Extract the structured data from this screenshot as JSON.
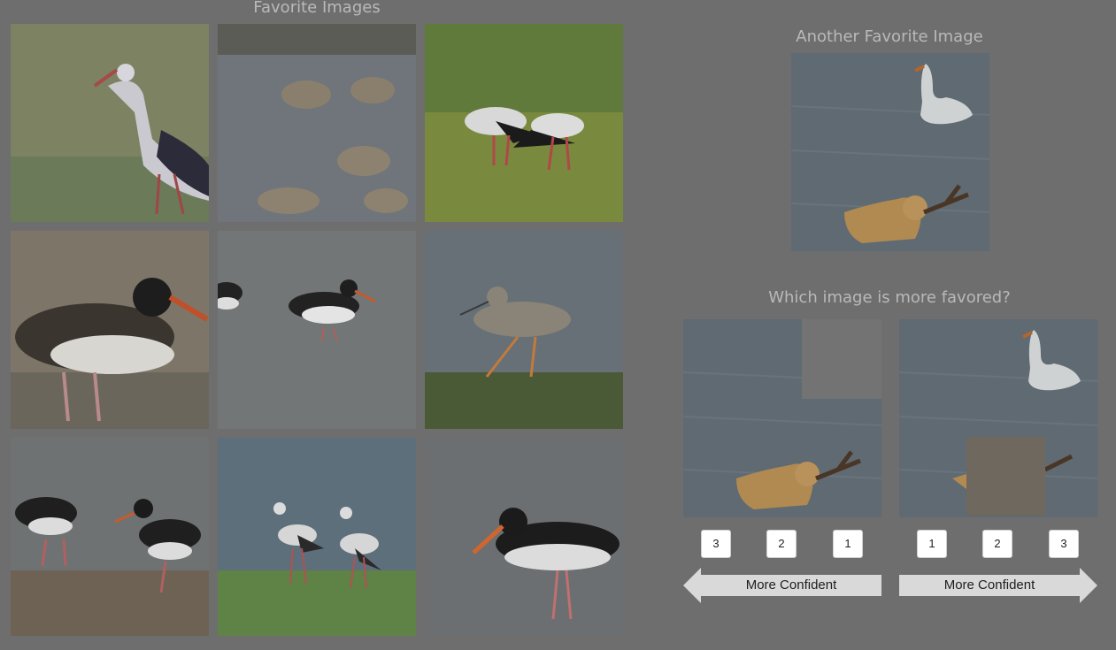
{
  "grid": {
    "title": "Favorite Images",
    "tiles": [
      {
        "subject": "white-stork"
      },
      {
        "subject": "godwits-flock"
      },
      {
        "subject": "two-storks-field"
      },
      {
        "subject": "oystercatcher-closeup"
      },
      {
        "subject": "oystercatchers-water"
      },
      {
        "subject": "redshank-rock"
      },
      {
        "subject": "two-oystercatchers-beach"
      },
      {
        "subject": "two-storks-grass"
      },
      {
        "subject": "oystercatcher-wading"
      }
    ]
  },
  "query": {
    "title": "Another Favorite Image",
    "subject": "swan-and-dog"
  },
  "comparison": {
    "question": "Which image is more favored?",
    "left_ranks": [
      "3",
      "2",
      "1"
    ],
    "right_ranks": [
      "1",
      "2",
      "3"
    ],
    "left_arrow_label": "More Confident",
    "right_arrow_label": "More Confident"
  }
}
